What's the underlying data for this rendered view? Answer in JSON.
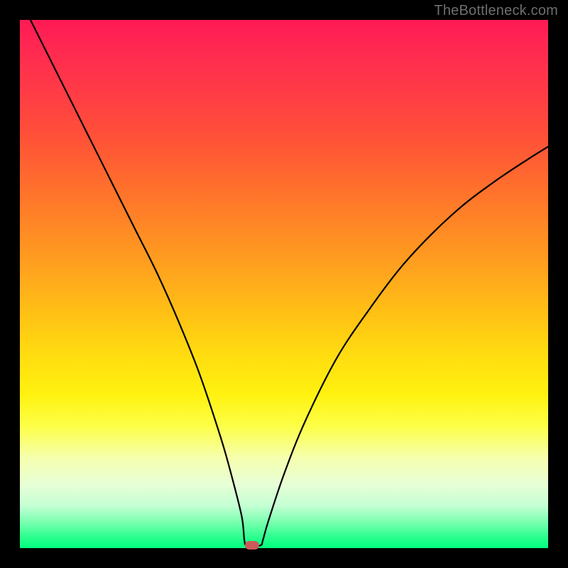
{
  "watermark": "TheBottleneck.com",
  "chart_data": {
    "type": "line",
    "title": "",
    "xlabel": "",
    "ylabel": "",
    "xlim": [
      0,
      100
    ],
    "ylim": [
      0,
      100
    ],
    "grid": false,
    "legend": false,
    "series": [
      {
        "name": "bottleneck-curve",
        "x": [
          2,
          6,
          10,
          14,
          18,
          22,
          26,
          30,
          34,
          38,
          40,
          42,
          42.5,
          43,
          45.5,
          46,
          47,
          50,
          54,
          60,
          66,
          72,
          78,
          84,
          90,
          96,
          100
        ],
        "y": [
          100,
          92,
          84,
          76,
          68,
          60,
          52,
          43,
          33,
          21,
          14,
          6,
          1.5,
          0.5,
          0.5,
          1.5,
          5,
          14,
          24,
          36,
          45,
          53,
          59.5,
          65,
          69.5,
          73.5,
          76
        ]
      }
    ],
    "marker": {
      "x": 44,
      "y": 0.5,
      "color": "#cc5a5a"
    },
    "gradient_stops": [
      {
        "pos": 0,
        "color": "#ff1a55"
      },
      {
        "pos": 50,
        "color": "#ffc214"
      },
      {
        "pos": 80,
        "color": "#fdff48"
      },
      {
        "pos": 100,
        "color": "#00ff7f"
      }
    ]
  }
}
